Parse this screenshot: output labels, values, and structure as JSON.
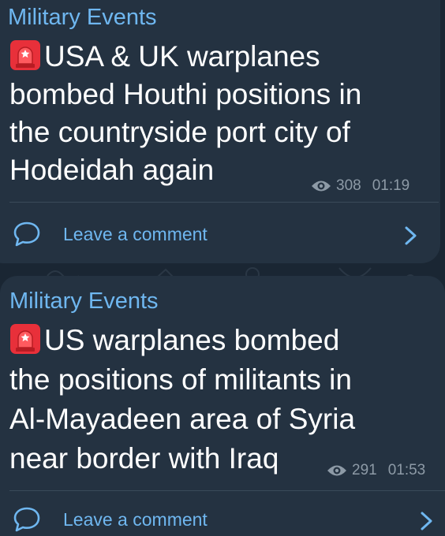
{
  "messages": [
    {
      "channel": "Military Events",
      "lines": [
        "USA & UK warplanes",
        "bombed Houthi positions in",
        "the countryside port city of",
        "Hodeidah again"
      ],
      "views": "308",
      "time": "01:19",
      "comment_label": "Leave a comment",
      "icon": "siren-emoji"
    },
    {
      "channel": "Military Events",
      "lines": [
        "US warplanes bombed",
        "the positions of militants in",
        "Al-Mayadeen area of Syria",
        "near border with Iraq"
      ],
      "views": "291",
      "time": "01:53",
      "comment_label": "Leave a comment",
      "icon": "siren-emoji"
    }
  ],
  "colors": {
    "background": "#1a2633",
    "bubble": "#243241",
    "accent": "#6fb7f0",
    "meta_text": "#8d9aa6",
    "text": "#ffffff"
  }
}
